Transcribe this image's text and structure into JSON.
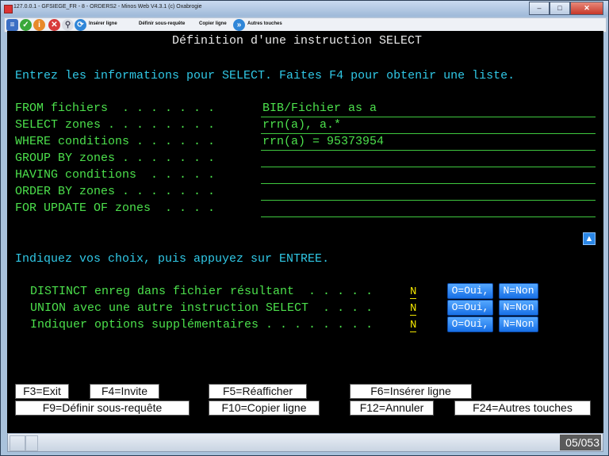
{
  "window": {
    "title": "127.0.0.1 - GFSIEGE_FR - 8 - ORDERS2 - Minos Web  V4.3.1 (c) Oxabrogie",
    "minimize": "–",
    "maximize": "□",
    "close": "✕"
  },
  "toolbar": {
    "insert_line": "Insérer ligne",
    "define_subquery": "Définir sous-requête",
    "copy_line": "Copier ligne",
    "other_keys": "Autres touches"
  },
  "screen": {
    "heading": "Définition d'une instruction SELECT",
    "instruction": "Entrez les informations pour SELECT. Faites F4 pour obtenir une liste.",
    "fields": [
      {
        "label": "FROM fichiers  . . . . . . .",
        "value": "BIB/Fichier as a"
      },
      {
        "label": "SELECT zones . . . . . . . .",
        "value": "rrn(a), a.*"
      },
      {
        "label": "WHERE conditions . . . . . .",
        "value": "rrn(a) = 95373954"
      },
      {
        "label": "GROUP BY zones . . . . . . .",
        "value": ""
      },
      {
        "label": "HAVING conditions  . . . . .",
        "value": ""
      },
      {
        "label": "ORDER BY zones . . . . . . .",
        "value": ""
      },
      {
        "label": "FOR UPDATE OF zones  . . . .",
        "value": ""
      }
    ],
    "choose_prompt": "Indiquez vos choix, puis appuyez sur ENTREE.",
    "options": [
      {
        "label": "DISTINCT enreg dans fichier résultant  . . . . .",
        "value": "N",
        "yes": "O=Oui,",
        "no": "N=Non"
      },
      {
        "label": "UNION avec une autre instruction SELECT  . . . .",
        "value": "N",
        "yes": "O=Oui,",
        "no": "N=Non"
      },
      {
        "label": "Indiquer options supplémentaires . . . . . . . .",
        "value": "N",
        "yes": "O=Oui,",
        "no": "N=Non"
      }
    ],
    "fkeys": {
      "f3": "F3=Exit",
      "f4": "F4=Invite",
      "f5": "F5=Réafficher",
      "f6": "F6=Insérer ligne",
      "f9": "F9=Définir sous-requête",
      "f10": "F10=Copier ligne",
      "f12": "F12=Annuler",
      "f24": "F24=Autres touches"
    }
  },
  "status": {
    "position": "05/053"
  },
  "icons": [
    "app-icon",
    "list-icon",
    "check-icon",
    "info-icon",
    "cancel-icon",
    "search-icon",
    "refresh-icon",
    "more-keys-icon",
    "scroll-up-icon"
  ]
}
